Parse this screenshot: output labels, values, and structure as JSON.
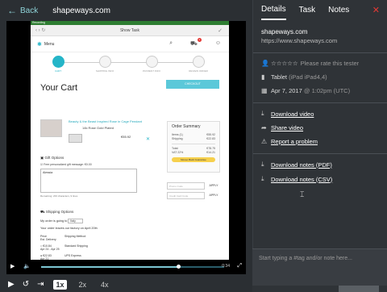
{
  "header": {
    "back_label": "Back",
    "site": "shapeways.com"
  },
  "recording": {
    "rec_label": "Recording",
    "browser_title": "Show Task",
    "menu_label": "Menu",
    "steps": [
      "CART",
      "SHIPPING INFO",
      "PAYMENT INFO",
      "REVIEW ORDER"
    ],
    "cart_title": "Your Cart",
    "checkout_label": "CHECKOUT",
    "product": {
      "name": "Beauty & the Beast Inspired Rose in Cage Pendant",
      "material": "14k Rose Gold Plated",
      "price": "€55.92"
    },
    "summary": {
      "title": "Order Summary",
      "items_label": "Items (1)",
      "items_value": "€55.92",
      "shipping_label": "Shipping",
      "shipping_value": "€22.83",
      "total_label": "Total:",
      "total_value": "€78.75",
      "vat_label": "VAT 22%",
      "vat_value": "€14.21",
      "guarantee": "Moneo Back Guarantee"
    },
    "coupon_placeholder": "Promo Code",
    "credit_placeholder": "Credit Card Code",
    "apply_label": "APPLY",
    "gift": {
      "heading": "Gift Options",
      "checkbox_label": "Free personalized gift message: €0.00",
      "message": "Alessia",
      "remaining": "Remaining: 233 characters, 9 lines"
    },
    "shipping": {
      "heading": "Shipping Options",
      "going_to_label": "My order is going to",
      "country": "Italy",
      "leaves_text": "Your order leaves our factory on April 20th",
      "col_price": "Price",
      "col_delivery": "Est. Delivery",
      "col_method": "Shipping Method",
      "opt1_price": "€10.84",
      "opt1_dates": "Apr 24 - Apr 25",
      "opt1_method": "Standard Shipping",
      "opt2_price": "€22.83",
      "opt2_dates": "Apr 21",
      "opt2_method": "UPS Express"
    }
  },
  "player": {
    "time": "0:34",
    "progress": 0.75,
    "speeds": [
      "1x",
      "2x",
      "4x"
    ],
    "active_speed": "1x"
  },
  "panel": {
    "tabs": [
      "Details",
      "Task",
      "Notes"
    ],
    "active_tab": "Details",
    "site_name": "shapeways.com",
    "site_url": "https://www.shapeways.com",
    "rate_label": "Please rate this tester",
    "device_label": "Tablet",
    "device_detail": "(iPad iPad4,4)",
    "date_label": "Apr 7, 2017",
    "time_detail": "@ 1:02pm (UTC)",
    "actions": [
      "Download video",
      "Share video",
      "Report a problem"
    ],
    "downloads": [
      "Download notes (PDF)",
      "Download notes (CSV)"
    ],
    "note_placeholder": "Start typing a #tag and/or note here..."
  },
  "colors": {
    "accent": "#25b5c8",
    "background": "#2b2f33",
    "close": "#e53935"
  }
}
